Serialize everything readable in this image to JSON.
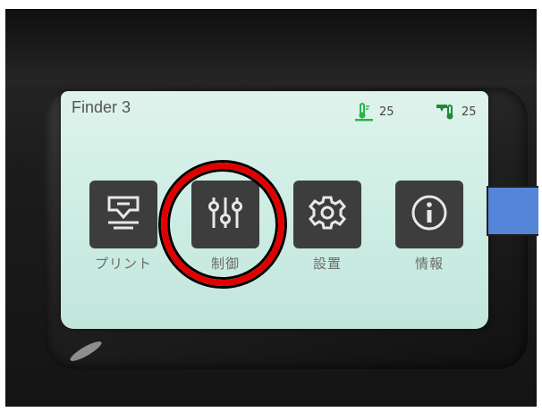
{
  "screen": {
    "title": "Finder 3",
    "bed_temp": "25",
    "nozzle_temp": "25"
  },
  "menu": {
    "items": [
      {
        "label": "プリント",
        "icon": "print-icon"
      },
      {
        "label": "制御",
        "icon": "sliders-icon"
      },
      {
        "label": "設置",
        "icon": "gear-icon"
      },
      {
        "label": "情報",
        "icon": "info-icon"
      }
    ]
  },
  "colors": {
    "screen_bg": "#d6f1e9",
    "tile_bg": "#3d3d3d",
    "highlight": "#e00000",
    "arrow": "#5585d9",
    "bed_icon": "#2bb54b",
    "nozzle_icon": "#1f8a3a"
  }
}
